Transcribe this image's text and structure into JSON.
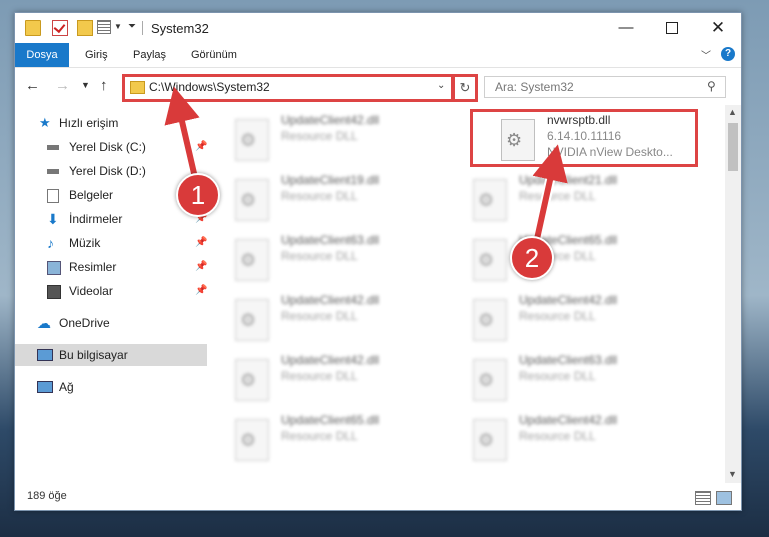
{
  "window": {
    "title": "System32",
    "ribbon_tabs": [
      "Dosya",
      "Giriş",
      "Paylaş",
      "Görünüm"
    ]
  },
  "nav": {
    "address": "C:\\Windows\\System32",
    "search_placeholder": "Ara: System32"
  },
  "sidebar": {
    "items": [
      {
        "label": "Hızlı erişim",
        "icon": "star-icon"
      },
      {
        "label": "Yerel Disk (C:)",
        "icon": "drive-icon"
      },
      {
        "label": "Yerel Disk (D:)",
        "icon": "drive-icon"
      },
      {
        "label": "Belgeler",
        "icon": "documents-icon"
      },
      {
        "label": "İndirmeler",
        "icon": "download-icon"
      },
      {
        "label": "Müzik",
        "icon": "music-icon"
      },
      {
        "label": "Resimler",
        "icon": "pictures-icon"
      },
      {
        "label": "Videolar",
        "icon": "video-icon"
      },
      {
        "label": "OneDrive",
        "icon": "cloud-icon"
      },
      {
        "label": "Bu bilgisayar",
        "icon": "computer-icon"
      },
      {
        "label": "Ağ",
        "icon": "network-icon"
      }
    ]
  },
  "files": {
    "highlighted": {
      "name": "nvwrsptb.dll",
      "version": "6.14.10.11116",
      "description": "NVIDIA nView Deskto..."
    },
    "left_column": [
      {
        "name": "UpdateClient42.dll",
        "type": "Resource DLL"
      },
      {
        "name": "UpdateClient19.dll",
        "type": "Resource DLL"
      },
      {
        "name": "UpdateClient63.dll",
        "type": "Resource DLL"
      },
      {
        "name": "UpdateClient42.dll",
        "type": "Resource DLL"
      },
      {
        "name": "UpdateClient42.dll",
        "type": "Resource DLL"
      },
      {
        "name": "UpdateClient65.dll",
        "type": "Resource DLL"
      }
    ],
    "right_column": [
      {
        "name": "UpdateClient21.dll",
        "type": "Resource DLL"
      },
      {
        "name": "UpdateClient65.dll",
        "type": "Resource DLL"
      },
      {
        "name": "UpdateClient42.dll",
        "type": "Resource DLL"
      },
      {
        "name": "UpdateClient63.dll",
        "type": "Resource DLL"
      },
      {
        "name": "UpdateClient42.dll",
        "type": "Resource DLL"
      }
    ]
  },
  "status": {
    "item_count": "189 öğe"
  },
  "callouts": [
    "1",
    "2"
  ],
  "colors": {
    "accent": "#1979ca",
    "highlight": "#d44444",
    "callout": "#d93a3a"
  }
}
